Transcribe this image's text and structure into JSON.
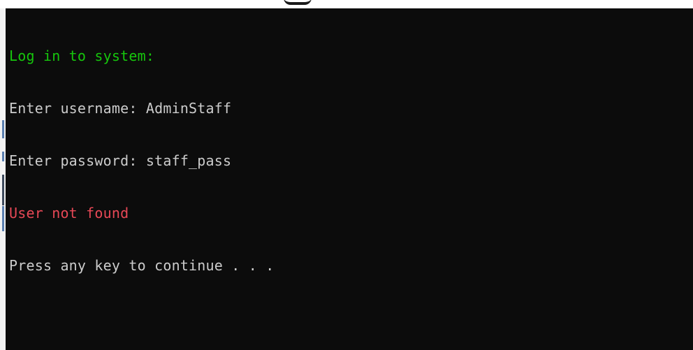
{
  "colors": {
    "background": "#0c0c0c",
    "default_text": "#cccccc",
    "prompt_text": "#16c60c",
    "error_text": "#e74856"
  },
  "console": {
    "lines": [
      {
        "text": "Log in to system:",
        "color": "#16c60c"
      },
      {
        "text": "Enter username: AdminStaff",
        "color": "#cccccc"
      },
      {
        "text": "Enter password: staff_pass",
        "color": "#cccccc"
      },
      {
        "text": "User not found",
        "color": "#e74856"
      },
      {
        "text": "Press any key to continue . . .",
        "color": "#cccccc"
      }
    ]
  }
}
